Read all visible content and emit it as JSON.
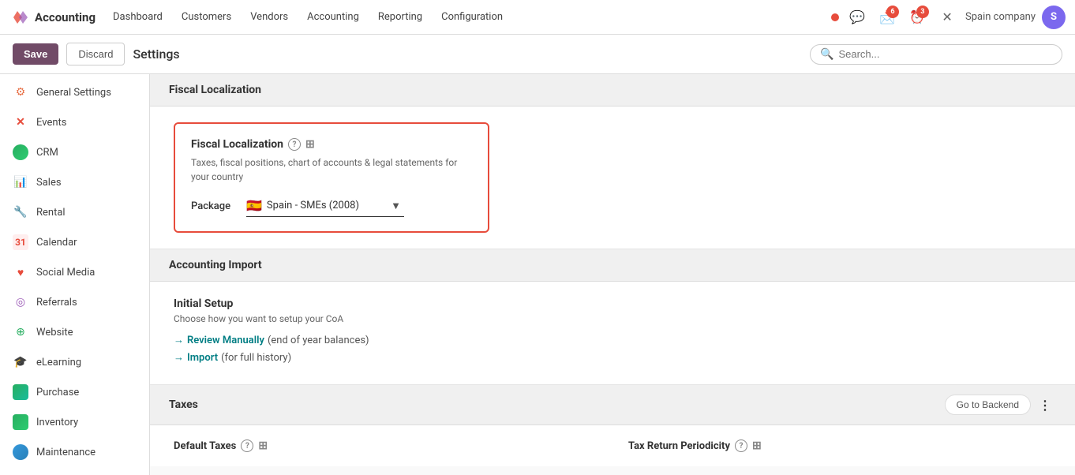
{
  "nav": {
    "brand": "Accounting",
    "logo_letters": "X",
    "items": [
      "Dashboard",
      "Customers",
      "Vendors",
      "Accounting",
      "Reporting",
      "Configuration"
    ],
    "company": "Spain company",
    "notifications": {
      "messages": "6",
      "clock": "3"
    },
    "avatar_text": "S"
  },
  "toolbar": {
    "save_label": "Save",
    "discard_label": "Discard",
    "settings_title": "Settings",
    "search_placeholder": "Search..."
  },
  "sidebar": {
    "items": [
      {
        "label": "General Settings",
        "icon": "⚙",
        "color": "#e8734a",
        "active": false
      },
      {
        "label": "Events",
        "icon": "✕",
        "color": "#e74c3c",
        "active": false
      },
      {
        "label": "CRM",
        "icon": "◉",
        "color": "#27ae60",
        "active": false
      },
      {
        "label": "Sales",
        "icon": "📊",
        "color": "#e74c3c",
        "active": false
      },
      {
        "label": "Rental",
        "icon": "🔧",
        "color": "#3498db",
        "active": false
      },
      {
        "label": "Calendar",
        "icon": "31",
        "color": "#e74c3c",
        "active": false
      },
      {
        "label": "Social Media",
        "icon": "♥",
        "color": "#e74c3c",
        "active": false
      },
      {
        "label": "Referrals",
        "icon": "◎",
        "color": "#9b59b6",
        "active": false
      },
      {
        "label": "Website",
        "icon": "⊕",
        "color": "#27ae60",
        "active": false
      },
      {
        "label": "eLearning",
        "icon": "🎓",
        "color": "#2c3e50",
        "active": false
      },
      {
        "label": "Purchase",
        "icon": "🛒",
        "color": "#27ae60",
        "active": false
      },
      {
        "label": "Inventory",
        "icon": "▦",
        "color": "#27ae60",
        "active": false
      },
      {
        "label": "Maintenance",
        "icon": "◑",
        "color": "#3498db",
        "active": false
      }
    ]
  },
  "fiscal_localization": {
    "section_title": "Fiscal Localization",
    "box_title": "Fiscal Localization",
    "box_desc": "Taxes, fiscal positions, chart of accounts & legal statements for your country",
    "package_label": "Package",
    "package_value": "Spain - SMEs (2008)",
    "package_flag": "🇪🇸"
  },
  "accounting_import": {
    "section_title": "Accounting Import",
    "initial_setup_title": "Initial Setup",
    "initial_setup_desc": "Choose how you want to setup your CoA",
    "link1_text": "Review Manually",
    "link1_suffix": "(end of year balances)",
    "link2_text": "Import",
    "link2_suffix": "(for full history)"
  },
  "taxes": {
    "section_title": "Taxes",
    "go_to_backend": "Go to Backend",
    "default_taxes_title": "Default Taxes",
    "tax_return_periodicity_title": "Tax Return Periodicity",
    "three_dots": "⋮"
  }
}
